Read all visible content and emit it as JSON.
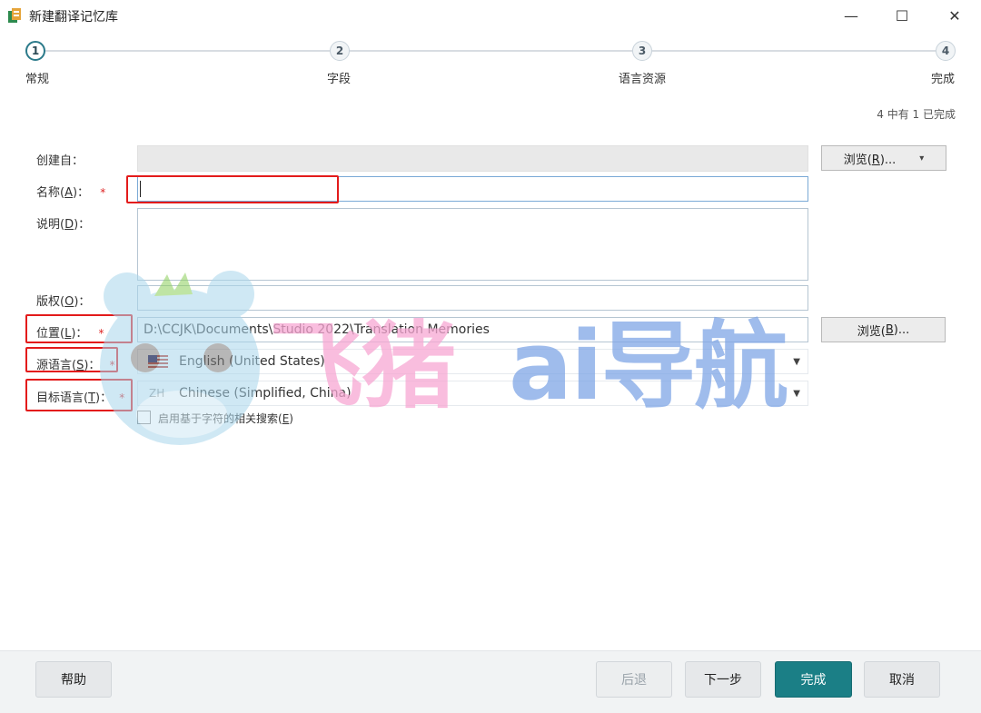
{
  "window": {
    "title": "新建翻译记忆库",
    "minimize_glyph": "—",
    "maximize_glyph": "☐",
    "close_glyph": "✕"
  },
  "steps": [
    {
      "num": "1",
      "label": "常规"
    },
    {
      "num": "2",
      "label": "字段"
    },
    {
      "num": "3",
      "label": "语言资源"
    },
    {
      "num": "4",
      "label": "完成"
    }
  ],
  "progress": "4 中有 1 已完成",
  "form": {
    "created_from": {
      "label": "创建自：",
      "value": ""
    },
    "browse_top": {
      "label_pre": "浏览(",
      "key": "R",
      "label_post": ")...",
      "arrow": "▾"
    },
    "name": {
      "label_pre": "名称(",
      "key": "A",
      "label_post": ")：",
      "req": "*",
      "value": ""
    },
    "description": {
      "label_pre": "说明(",
      "key": "D",
      "label_post": ")：",
      "value": ""
    },
    "copyright": {
      "label_pre": "版权(",
      "key": "O",
      "label_post": ")：",
      "value": ""
    },
    "location": {
      "label_pre": "位置(",
      "key": "L",
      "label_post": ")：",
      "req": "*",
      "value": "D:\\CCJK\\Documents\\Studio 2022\\Translation Memories"
    },
    "browse_location": {
      "label_pre": "浏览(",
      "key": "B",
      "label_post": ")..."
    },
    "source_lang": {
      "label_pre": "源语言(",
      "key": "S",
      "label_post": ")：",
      "req": "*",
      "value": "English (United States)"
    },
    "target_lang": {
      "label_pre": "目标语言(",
      "key": "T",
      "label_post": ")：",
      "req": "*",
      "code": "ZH",
      "value": "Chinese (Simplified, China)"
    },
    "char_search": {
      "label_pre": "启用基于字符的相关搜索(",
      "key": "E",
      "label_post": ")",
      "checked": false
    }
  },
  "footer": {
    "help": "帮助",
    "back": "后退",
    "next": "下一步",
    "finish": "完成",
    "cancel": "取消"
  },
  "watermark": {
    "text_pink": "飞猪",
    "text_blue": "ai导航"
  },
  "colors": {
    "accent": "#1b7f86",
    "required": "#dd2222",
    "highlight": "#e31b1b",
    "wm_pink": "#f7a8d3",
    "wm_blue": "#7fa6e6",
    "wm_panda": "#a9d6ec"
  }
}
